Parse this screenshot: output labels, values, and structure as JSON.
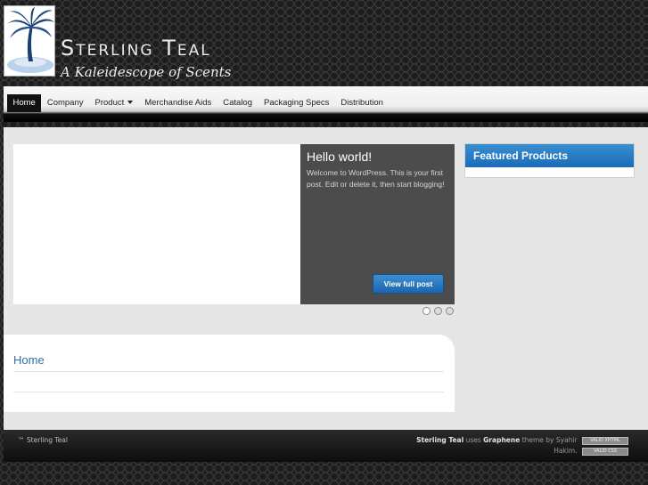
{
  "header": {
    "site_title": "Sterling Teal",
    "tagline": "A Kaleidescope of Scents"
  },
  "menu": {
    "items": [
      {
        "label": "Home",
        "active": true
      },
      {
        "label": "Company"
      },
      {
        "label": "Product",
        "has_dropdown": true
      },
      {
        "label": "Merchandise Aids"
      },
      {
        "label": "Catalog"
      },
      {
        "label": "Packaging Specs"
      },
      {
        "label": "Distribution"
      }
    ]
  },
  "slider": {
    "post_title": "Hello world!",
    "excerpt": "Welcome to WordPress. This is your first post. Edit or delete it, then start blogging!",
    "button_label": "View full post",
    "slide_count": 3,
    "active_slide": 1
  },
  "page": {
    "title": "Home"
  },
  "sidebar": {
    "widget_title": "Featured Products"
  },
  "footer": {
    "copyright": "™ Sterling Teal",
    "site_name": "Sterling Teal",
    "uses_text": "uses",
    "theme_name": "Graphene",
    "by_text": "theme by Syahir",
    "author_end": "Hakim.",
    "badge_1": "VALID XHTML",
    "badge_2": "VALID CSS"
  },
  "colors": {
    "accent_blue": "#1d6bb8",
    "title_blue": "#2f6fa8",
    "caption_bg": "#4c4c4c"
  }
}
